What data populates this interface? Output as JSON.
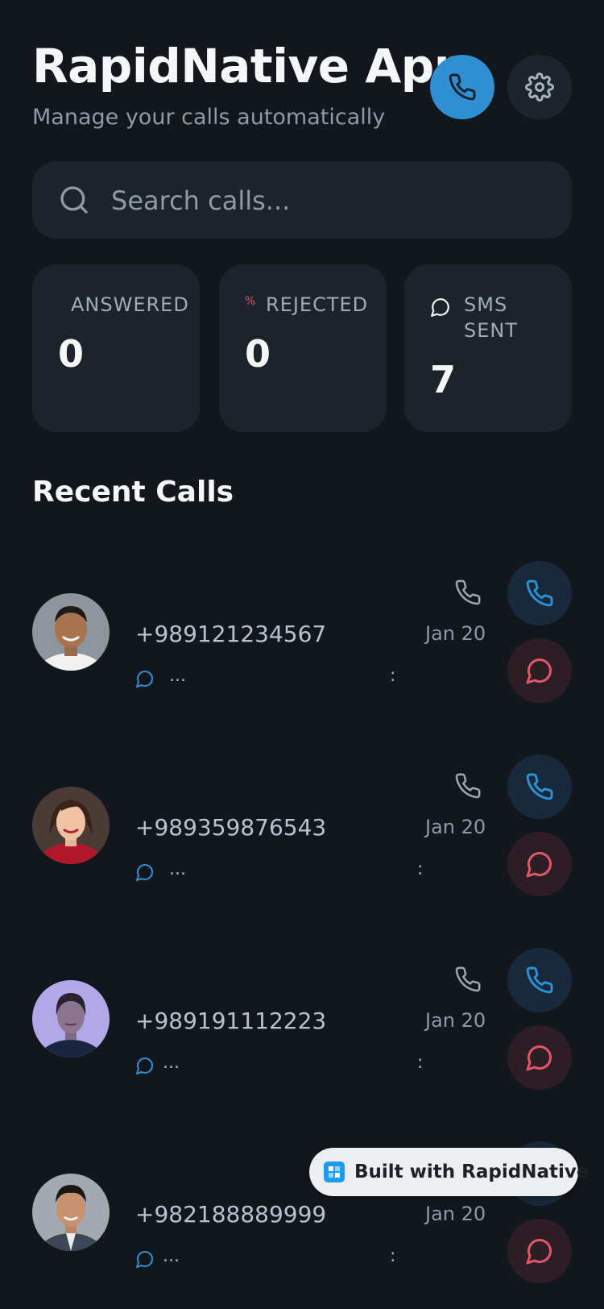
{
  "header": {
    "title": "RapidNative App",
    "subtitle": "Manage your calls automatically"
  },
  "search": {
    "placeholder": "Search calls..."
  },
  "stats": [
    {
      "label_line1": "ANSWERED",
      "label_line2": "",
      "value": "0"
    },
    {
      "label_line1": "REJECTED",
      "label_line2": "",
      "icon_text": "%",
      "value": "0"
    },
    {
      "label_line1": "SMS",
      "label_line2": "SENT",
      "value": "7"
    }
  ],
  "recent": {
    "title": "Recent Calls",
    "calls": [
      {
        "number": "+989121234567",
        "date": "Jan 20",
        "snippet": "...",
        "separator": ":",
        "avatar": "man-avatar-1"
      },
      {
        "number": "+989359876543",
        "date": "Jan 20",
        "snippet": "...",
        "separator": ":",
        "avatar": "woman-avatar-1"
      },
      {
        "number": "+989191112223",
        "date": "Jan 20",
        "snippet": "...",
        "separator": ":",
        "avatar": "woman-avatar-2"
      },
      {
        "number": "+982188889999",
        "date": "Jan 20",
        "snippet": "...",
        "separator": ":",
        "avatar": "man-avatar-2"
      }
    ]
  },
  "badge": {
    "text": "Built with RapidNative"
  },
  "colors": {
    "background": "#12171d",
    "card": "#1c232b",
    "accent_blue": "#2f8fd2",
    "sms_red": "#e0576b"
  }
}
